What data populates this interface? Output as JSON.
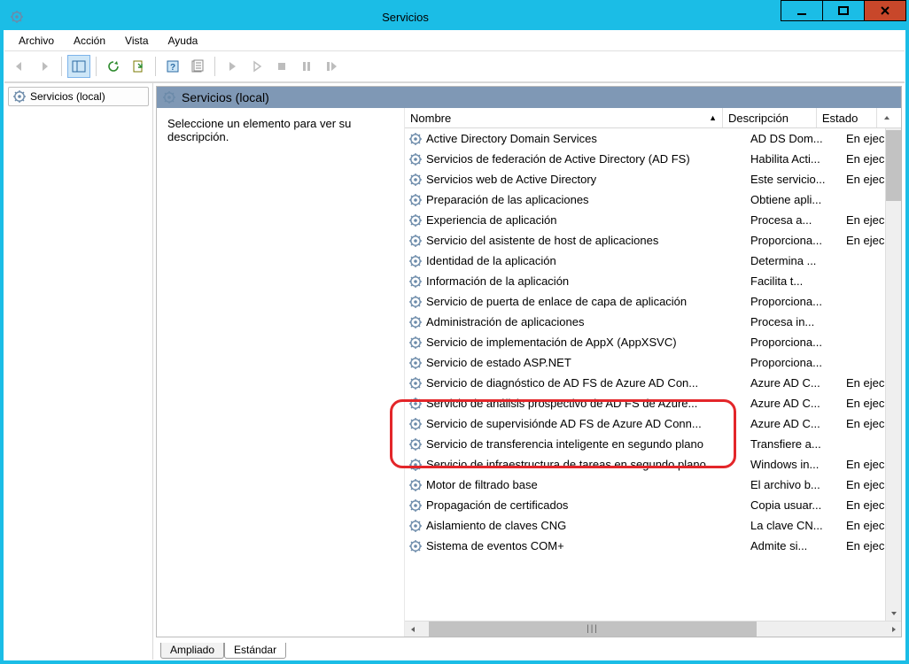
{
  "window": {
    "title": "Servicios"
  },
  "menu": {
    "file": "Archivo",
    "action": "Acción",
    "view": "Vista",
    "help": "Ayuda"
  },
  "tree": {
    "root": "Servicios (local)"
  },
  "pane": {
    "title": "Servicios (local)",
    "prompt": "Seleccione un elemento para ver su descripción."
  },
  "columns": {
    "name": "Nombre",
    "desc": "Descripción",
    "state": "Estado"
  },
  "tabs": {
    "extended": "Ampliado",
    "standard": "Estándar"
  },
  "services": [
    {
      "name": "Active Directory Domain Services",
      "desc": "AD DS Dom...",
      "state": "En ejec"
    },
    {
      "name": "Servicios de federación de Active Directory (AD FS)",
      "desc": "Habilita Acti...",
      "state": "En ejec"
    },
    {
      "name": "Servicios web de Active Directory",
      "desc": "Este servicio...",
      "state": "En ejec"
    },
    {
      "name": "Preparación de las aplicaciones",
      "desc": "Obtiene apli...",
      "state": ""
    },
    {
      "name": "Experiencia de aplicación",
      "desc": "Procesa a...",
      "state": "En ejec"
    },
    {
      "name": "Servicio del asistente de host de aplicaciones",
      "desc": "Proporciona...",
      "state": "En ejec"
    },
    {
      "name": "Identidad de la aplicación",
      "desc": "Determina ...",
      "state": ""
    },
    {
      "name": "Información de la aplicación",
      "desc": "Facilita t...",
      "state": ""
    },
    {
      "name": "Servicio de puerta de enlace de capa de aplicación",
      "desc": "Proporciona...",
      "state": ""
    },
    {
      "name": "Administración de aplicaciones",
      "desc": "Procesa in...",
      "state": ""
    },
    {
      "name": "Servicio de implementación de AppX (AppXSVC)",
      "desc": "Proporciona...",
      "state": ""
    },
    {
      "name": "Servicio de estado ASP.NET",
      "desc": "Proporciona...",
      "state": ""
    },
    {
      "name": "Servicio de diagnóstico de AD FS de Azure AD Con...",
      "desc": "Azure AD C...",
      "state": "En ejec"
    },
    {
      "name": "Servicio de análisis prospectivo de AD FS de Azure...",
      "desc": "Azure AD C...",
      "state": "En ejec"
    },
    {
      "name": "Servicio de supervisiónde AD FS de Azure AD Conn...",
      "desc": "Azure AD C...",
      "state": "En ejec"
    },
    {
      "name": "Servicio de transferencia inteligente en segundo plano",
      "desc": "Transfiere a...",
      "state": ""
    },
    {
      "name": "Servicio de infraestructura de tareas en segundo plano",
      "desc": "Windows in...",
      "state": "En ejec"
    },
    {
      "name": "Motor de filtrado base",
      "desc": "El archivo b...",
      "state": "En ejec"
    },
    {
      "name": "Propagación de certificados",
      "desc": "Copia usuar...",
      "state": "En ejec"
    },
    {
      "name": "Aislamiento de claves CNG",
      "desc": "La clave CN...",
      "state": "En ejec"
    },
    {
      "name": "Sistema de eventos COM+",
      "desc": "Admite si...",
      "state": "En ejec"
    }
  ]
}
